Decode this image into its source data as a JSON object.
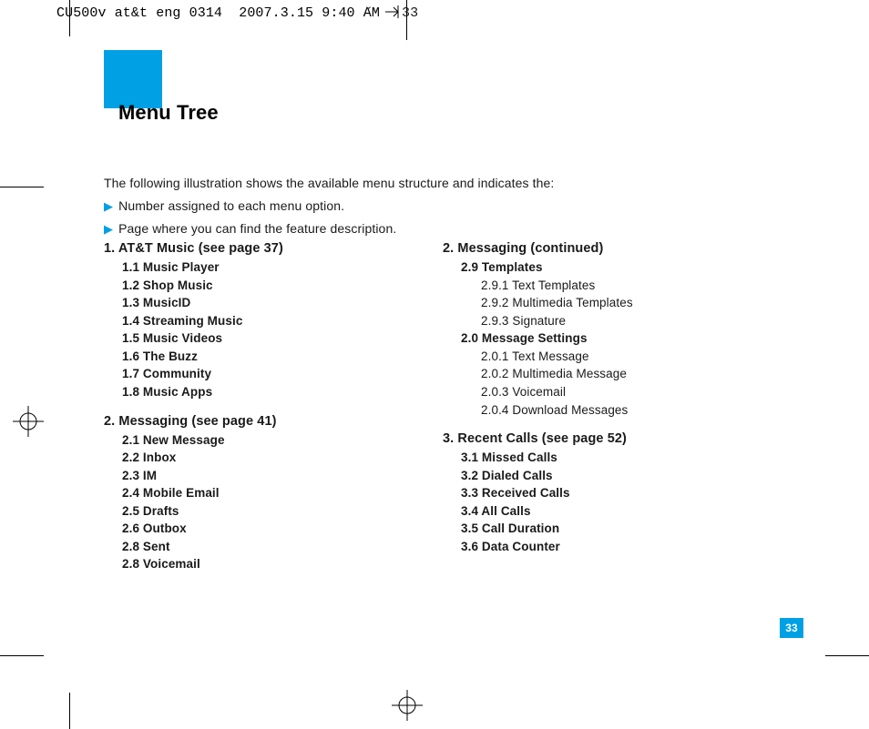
{
  "header": {
    "left": "CU500v at&t eng 0314  2007.3.15 9:40 AM",
    "tilde": "˘",
    "page_marker": "33"
  },
  "title": "Menu Tree",
  "intro_line": "The following illustration shows the available menu structure and indicates the:",
  "bullets": [
    "Number assigned to each menu option.",
    "Page where you can find the feature description."
  ],
  "col_left": {
    "sec1_head": "1.  AT&T Music (see page 37)",
    "sec1_items": [
      "1.1 Music Player",
      "1.2 Shop Music",
      "1.3 MusicID",
      "1.4 Streaming Music",
      "1.5 Music Videos",
      "1.6 The Buzz",
      "1.7 Community",
      "1.8 Music Apps"
    ],
    "sec2_head": "2.  Messaging (see page 41)",
    "sec2_items": [
      "2.1 New Message",
      "2.2 Inbox",
      "2.3 IM",
      "2.4 Mobile Email",
      "2.5 Drafts",
      "2.6 Outbox",
      "2.8 Sent",
      "2.8 Voicemail"
    ]
  },
  "col_right": {
    "sec1_head": "2.  Messaging (continued)",
    "sec1_g1_head": "2.9 Templates",
    "sec1_g1_items": [
      "2.9.1 Text Templates",
      "2.9.2 Multimedia Templates",
      "2.9.3 Signature"
    ],
    "sec1_g2_head": "2.0 Message Settings",
    "sec1_g2_items": [
      "2.0.1 Text Message",
      "2.0.2 Multimedia Message",
      "2.0.3 Voicemail",
      "2.0.4 Download Messages"
    ],
    "sec2_head": "3.  Recent Calls (see page 52)",
    "sec2_items": [
      "3.1 Missed Calls",
      "3.2 Dialed Calls",
      "3.3 Received Calls",
      "3.4 All Calls",
      "3.5 Call Duration",
      "3.6 Data Counter"
    ]
  },
  "page_number": "33"
}
